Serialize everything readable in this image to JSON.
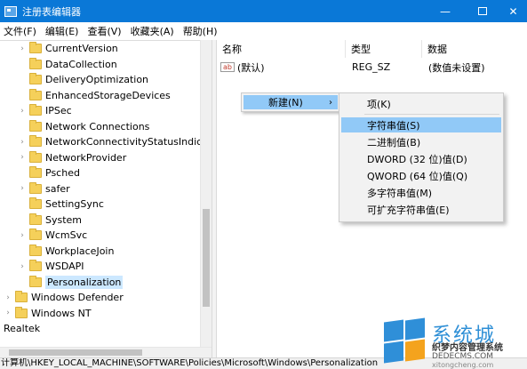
{
  "window": {
    "title": "注册表编辑器",
    "minimize": "—",
    "close": "✕",
    "accent": "#0a78d7"
  },
  "menu": [
    "文件(F)",
    "编辑(E)",
    "查看(V)",
    "收藏夹(A)",
    "帮助(H)"
  ],
  "tree": {
    "items": [
      {
        "label": "CurrentVersion",
        "arrow": "›"
      },
      {
        "label": "DataCollection",
        "arrow": ""
      },
      {
        "label": "DeliveryOptimization",
        "arrow": ""
      },
      {
        "label": "EnhancedStorageDevices",
        "arrow": ""
      },
      {
        "label": "IPSec",
        "arrow": "›"
      },
      {
        "label": "Network Connections",
        "arrow": ""
      },
      {
        "label": "NetworkConnectivityStatusIndicat",
        "arrow": "›"
      },
      {
        "label": "NetworkProvider",
        "arrow": "›"
      },
      {
        "label": "Psched",
        "arrow": ""
      },
      {
        "label": "safer",
        "arrow": "›"
      },
      {
        "label": "SettingSync",
        "arrow": ""
      },
      {
        "label": "System",
        "arrow": ""
      },
      {
        "label": "WcmSvc",
        "arrow": "›"
      },
      {
        "label": "WorkplaceJoin",
        "arrow": ""
      },
      {
        "label": "WSDAPI",
        "arrow": "›"
      },
      {
        "label": "Personalization",
        "arrow": "",
        "selected": true
      },
      {
        "label": "Windows Defender",
        "arrow": "›"
      },
      {
        "label": "Windows NT",
        "arrow": "›"
      },
      {
        "label": "Realtek",
        "arrow": ""
      }
    ]
  },
  "list": {
    "headers": [
      "名称",
      "类型",
      "数据"
    ],
    "rows": [
      {
        "name": "(默认)",
        "type": "REG_SZ",
        "data": "(数值未设置)",
        "icon": "ab"
      }
    ]
  },
  "context_menu": {
    "new_label": "新建(N)",
    "chevron": "›",
    "submenu": [
      "项(K)",
      "字符串值(S)",
      "二进制值(B)",
      "DWORD (32 位)值(D)",
      "QWORD (64 位)值(Q)",
      "多字符串值(M)",
      "可扩充字符串值(E)"
    ],
    "highlight": "#91c9f7"
  },
  "status": {
    "path": "计算机\\HKEY_LOCAL_MACHINE\\SOFTWARE\\Policies\\Microsoft\\Windows\\Personalization"
  },
  "watermark": {
    "main": "系统城",
    "line1": "织梦内容管理系统",
    "line2": "DEDECMS.COM",
    "line3": "xitongcheng.com"
  }
}
